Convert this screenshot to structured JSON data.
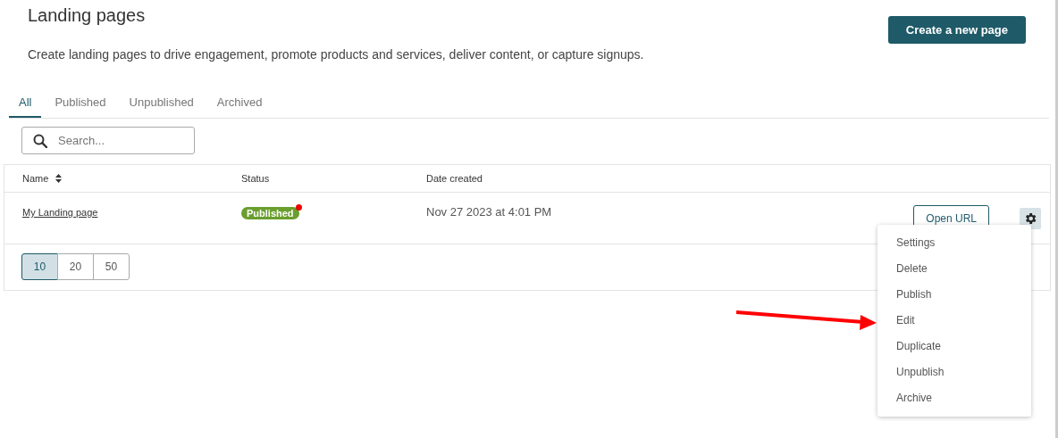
{
  "header": {
    "title": "Landing pages",
    "description": "Create landing pages to drive engagement, promote products and services, deliver content, or capture signups.",
    "create_button": "Create a new page"
  },
  "tabs": [
    {
      "label": "All",
      "selected": true
    },
    {
      "label": "Published",
      "selected": false
    },
    {
      "label": "Unpublished",
      "selected": false
    },
    {
      "label": "Archived",
      "selected": false
    }
  ],
  "search": {
    "placeholder": "Search..."
  },
  "table": {
    "columns": [
      {
        "label": "Name",
        "sortable": true
      },
      {
        "label": "Status",
        "sortable": false
      },
      {
        "label": "Date created",
        "sortable": false
      }
    ],
    "rows": [
      {
        "name": "My Landing page",
        "status": "Published",
        "date": "Nov 27 2023 at 4:01 PM",
        "open_button": "Open URL"
      }
    ]
  },
  "page_sizes": [
    {
      "label": "10",
      "selected": true
    },
    {
      "label": "20",
      "selected": false
    },
    {
      "label": "50",
      "selected": false
    }
  ],
  "menu": {
    "items": [
      "Settings",
      "Delete",
      "Publish",
      "Edit",
      "Duplicate",
      "Unpublish",
      "Archive"
    ]
  }
}
